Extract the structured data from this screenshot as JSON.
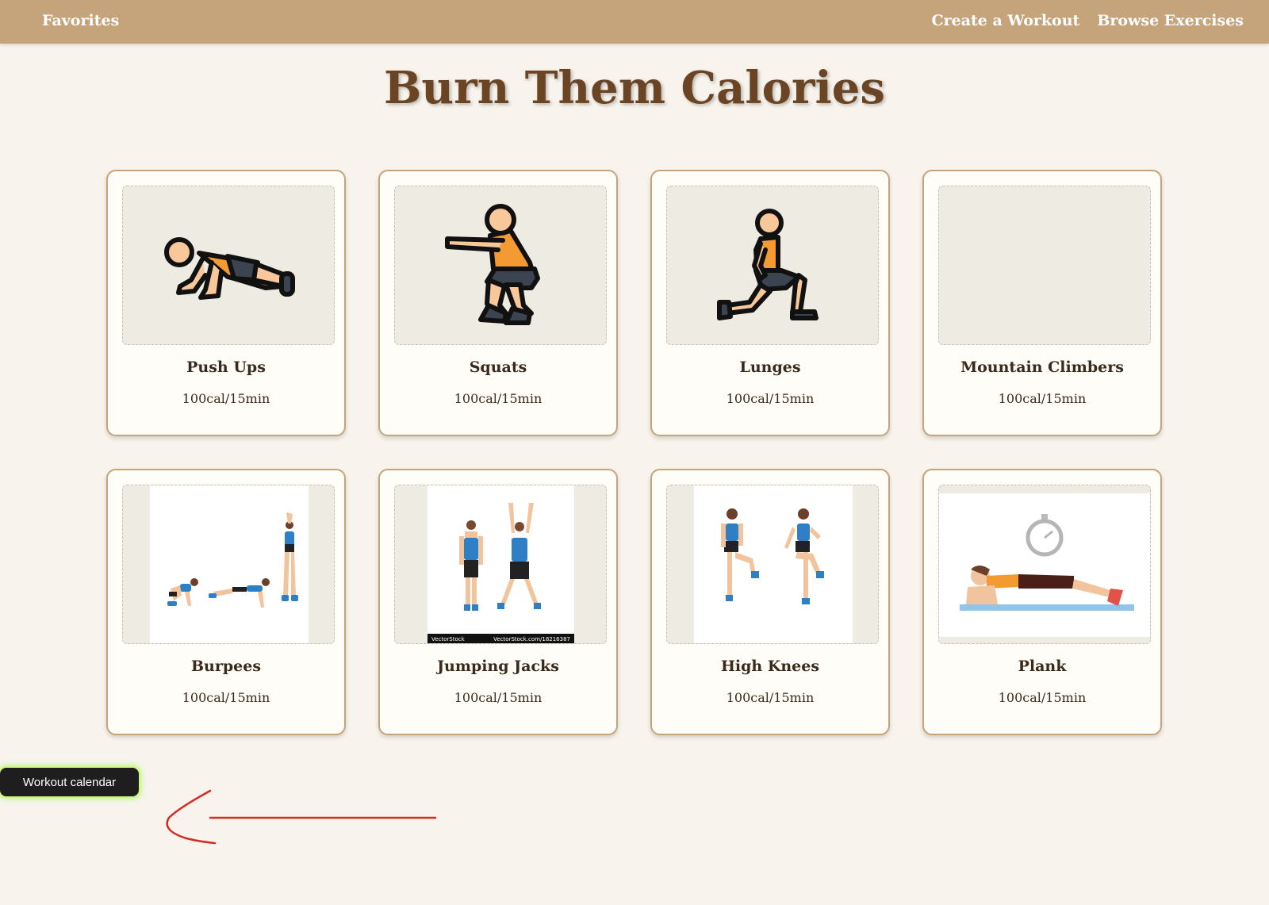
{
  "nav": {
    "favorites": "Favorites",
    "create_workout": "Create a Workout",
    "browse_exercises": "Browse Exercises"
  },
  "page": {
    "title": "Burn Them Calories"
  },
  "exercises": [
    {
      "name": "Push Ups",
      "calories": "100cal/15min"
    },
    {
      "name": "Squats",
      "calories": "100cal/15min"
    },
    {
      "name": "Lunges",
      "calories": "100cal/15min"
    },
    {
      "name": "Mountain Climbers",
      "calories": "100cal/15min"
    },
    {
      "name": "Burpees",
      "calories": "100cal/15min"
    },
    {
      "name": "Jumping Jacks",
      "calories": "100cal/15min",
      "watermark_left": "VectorStock",
      "watermark_right": "VectorStock.com/18216387"
    },
    {
      "name": "High Knees",
      "calories": "100cal/15min"
    },
    {
      "name": "Plank",
      "calories": "100cal/15min"
    }
  ],
  "calendar_button": {
    "label": "Workout calendar"
  },
  "annotation": {
    "arrow_color": "#d42a24"
  },
  "colors": {
    "nav_background": "#c6a47b",
    "page_background": "#f8f4ed",
    "title_color": "#6b4424",
    "card_border": "#c6a47b",
    "icon_orange": "#f49a33",
    "skin": "#f8c79a",
    "shorts": "#3b4450",
    "athlete_blue": "#2f7fc4"
  }
}
